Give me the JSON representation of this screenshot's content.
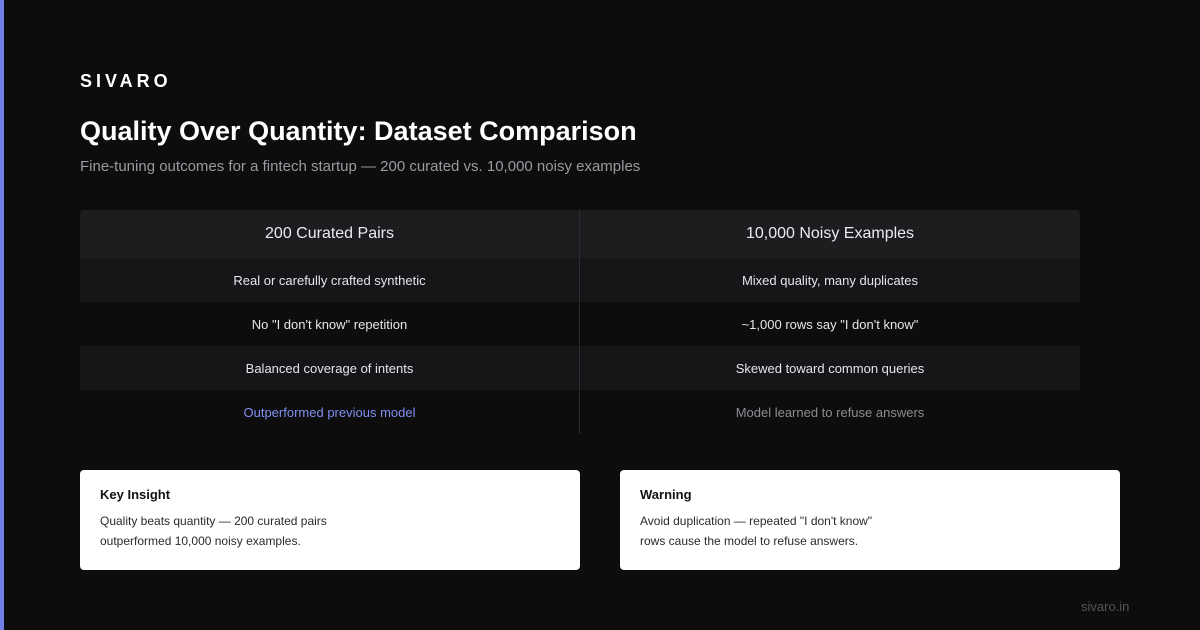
{
  "brand": "SIVARO",
  "title": "Quality Over Quantity: Dataset Comparison",
  "subtitle": "Fine-tuning outcomes for a fintech startup — 200 curated vs. 10,000 noisy examples",
  "colors": {
    "accent": "#6f7fe6",
    "background": "#0d0d0d",
    "highlight": "#7f8ff0"
  },
  "table": {
    "headers": [
      "200 Curated Pairs",
      "10,000 Noisy Examples"
    ],
    "rows": [
      [
        "Real or carefully crafted synthetic",
        "Mixed quality, many duplicates"
      ],
      [
        "No \"I don't know\" repetition",
        "~1,000 rows say \"I don't know\""
      ],
      [
        "Balanced coverage of intents",
        "Skewed toward common queries"
      ],
      [
        "Outperformed previous model",
        "Model learned to refuse answers"
      ]
    ]
  },
  "cards": [
    {
      "title": "Key Insight",
      "lines": [
        "Quality beats quantity — 200 curated pairs",
        "outperformed 10,000 noisy examples."
      ]
    },
    {
      "title": "Warning",
      "lines": [
        "Avoid duplication — repeated \"I don't know\"",
        "rows cause the model to refuse answers."
      ]
    }
  ],
  "footer": "sivaro.in"
}
